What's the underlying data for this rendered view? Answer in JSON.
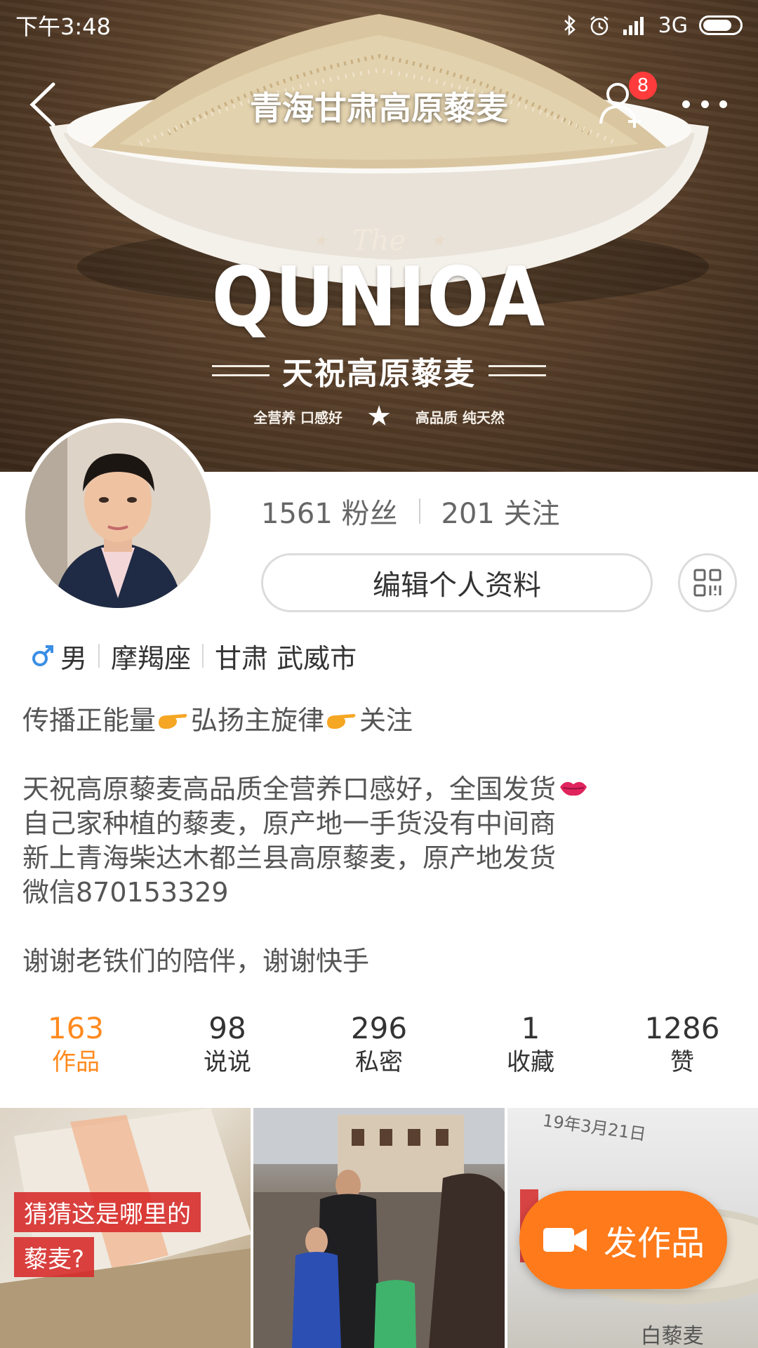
{
  "status_bar": {
    "time": "下午3:48",
    "network": "3G"
  },
  "nav": {
    "title": "青海甘肃高原藜麦",
    "notification_count": "8"
  },
  "banner": {
    "logo_the": "The",
    "logo_main": "QUNIOA",
    "logo_cn": "天祝高原藜麦",
    "tag_left": "全营养 口感好",
    "tag_right": "高品质 纯天然"
  },
  "profile": {
    "fans": "1561 粉丝",
    "following": "201 关注",
    "edit_label": "编辑个人资料",
    "gender": "男",
    "zodiac": "摩羯座",
    "location": "甘肃 武威市"
  },
  "bio": {
    "line1_a": "传播正能量",
    "line1_b": "弘扬主旋律",
    "line1_c": "关注",
    "line2": "天祝高原藜麦高品质全营养口感好，全国发货",
    "line3": "自己家种植的藜麦，原产地一手货没有中间商",
    "line4": "新上青海柴达木都兰县高原藜麦，原产地发货",
    "line5": "微信870153329",
    "line6": "谢谢老铁们的陪伴，谢谢快手"
  },
  "counts": [
    {
      "num": "163",
      "label": "作品"
    },
    {
      "num": "98",
      "label": "说说"
    },
    {
      "num": "296",
      "label": "私密"
    },
    {
      "num": "1",
      "label": "收藏"
    },
    {
      "num": "1286",
      "label": "赞"
    }
  ],
  "grid": {
    "thumb1_caption1": "猜猜这是哪里的",
    "thumb1_caption2": "藜麦?",
    "thumb3_date": "19年3月21日",
    "thumb3_label": "白藜麦"
  },
  "publish": {
    "label": "发作品"
  },
  "colors": {
    "accent": "#ff8a1e",
    "publish": "#ff7a1a",
    "badge": "#ff3b3b",
    "caption": "#d62828"
  }
}
